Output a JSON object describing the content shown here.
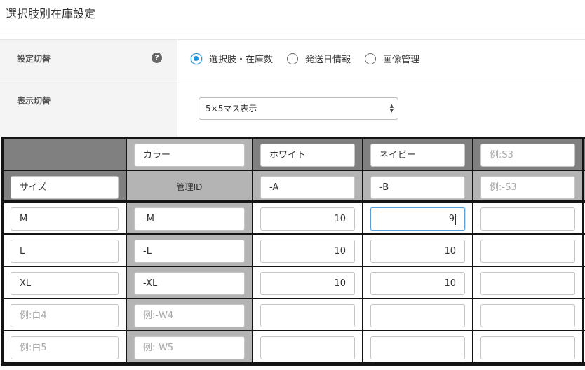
{
  "page": {
    "title": "選択肢別在庫設定"
  },
  "settings": {
    "switch_label": "設定切替",
    "help_icon": "question-circle-icon",
    "radios": [
      {
        "label": "選択肢・在庫数",
        "checked": true
      },
      {
        "label": "発送日情報",
        "checked": false
      },
      {
        "label": "画像管理",
        "checked": false
      }
    ],
    "display_label": "表示切替",
    "display_select": {
      "value": "5×5マス表示"
    }
  },
  "grid": {
    "axis_col_label_value": "カラー",
    "axis_row_label_value": "サイズ",
    "management_id_label": "管理ID",
    "columns": [
      {
        "name_value": "ホワイト",
        "name_placeholder": "",
        "id_value": "-A",
        "id_placeholder": ""
      },
      {
        "name_value": "ネイビー",
        "name_placeholder": "",
        "id_value": "-B",
        "id_placeholder": ""
      },
      {
        "name_value": "",
        "name_placeholder": "例:S3",
        "id_value": "",
        "id_placeholder": "例:-S3"
      }
    ],
    "rows": [
      {
        "name_value": "M",
        "name_placeholder": "",
        "id_value": "-M",
        "id_placeholder": "",
        "stock": [
          "10",
          "9",
          ""
        ]
      },
      {
        "name_value": "L",
        "name_placeholder": "",
        "id_value": "-L",
        "id_placeholder": "",
        "stock": [
          "10",
          "10",
          ""
        ]
      },
      {
        "name_value": "XL",
        "name_placeholder": "",
        "id_value": "-XL",
        "id_placeholder": "",
        "stock": [
          "10",
          "10",
          ""
        ]
      },
      {
        "name_value": "",
        "name_placeholder": "例:白4",
        "id_value": "",
        "id_placeholder": "例:-W4",
        "stock": [
          "",
          "",
          ""
        ]
      },
      {
        "name_value": "",
        "name_placeholder": "例:白5",
        "id_value": "",
        "id_placeholder": "例:-W5",
        "stock": [
          "",
          "",
          ""
        ]
      }
    ],
    "focused_cell": {
      "row": 0,
      "col": 1
    }
  }
}
